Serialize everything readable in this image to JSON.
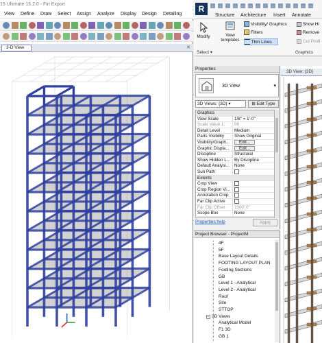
{
  "etabs": {
    "title": "15 Ultimate 15.2.0 - Fin Export",
    "menu": [
      "View",
      "Define",
      "Draw",
      "Select",
      "Assign",
      "Analyze",
      "Display",
      "Design",
      "Detailing"
    ],
    "view_tab": "3-D View",
    "colors": {
      "frame": "#2f3f9e",
      "slab": "#7d7d7d",
      "grid": "#c9c9c9"
    }
  },
  "revit": {
    "logo": "R",
    "ribbon_tabs": [
      "Structure",
      "Architecture",
      "Insert",
      "Annotate"
    ],
    "ribbon": {
      "modify": "Modify",
      "view_templates": "View templates",
      "visibility_graphics": "Visibility/ Graphics",
      "filters": "Filters",
      "thin_lines": "Thin Lines",
      "show_hidden": "Show Hi",
      "remove": "Remove",
      "cut_profile": "Cut Profi",
      "select_panel": "Select",
      "graphics_panel": "Graphics"
    },
    "properties": {
      "title": "Properties",
      "type_name": "3D View",
      "instance": "3D Views: {3D}",
      "edit_type": "Edit Type",
      "rows": [
        {
          "k": "Graphics",
          "v": "",
          "group": true
        },
        {
          "k": "View Scale",
          "v": "1/8\" = 1'-0\""
        },
        {
          "k": "Scale Value 1:",
          "v": "96",
          "disabled": true
        },
        {
          "k": "Detail Level",
          "v": "Medium"
        },
        {
          "k": "Parts Visibility",
          "v": "Show Original"
        },
        {
          "k": "Visibility/Graph...",
          "v": "Edit...",
          "button": true
        },
        {
          "k": "Graphic Displa...",
          "v": "Edit...",
          "button": true
        },
        {
          "k": "Discipline",
          "v": "Structural"
        },
        {
          "k": "Show Hidden L...",
          "v": "By Discipline"
        },
        {
          "k": "Default Analysi...",
          "v": "None"
        },
        {
          "k": "Sun Path",
          "v": "",
          "check": true
        },
        {
          "k": "Extents",
          "v": "",
          "group": true
        },
        {
          "k": "Crop View",
          "v": "",
          "check": true
        },
        {
          "k": "Crop Region Vi...",
          "v": "",
          "check": true
        },
        {
          "k": "Annotation Crop",
          "v": "",
          "check": true
        },
        {
          "k": "Far Clip Active",
          "v": "",
          "check": true
        },
        {
          "k": "Far Clip Offset",
          "v": "1000' 0\"",
          "disabled": true
        },
        {
          "k": "Scope Box",
          "v": "None"
        }
      ],
      "help": "Properties help",
      "apply": "Apply"
    },
    "browser": {
      "title": "Project Browser - ProjectM",
      "items": [
        {
          "label": "4F",
          "indent": 2
        },
        {
          "label": "5F",
          "indent": 2
        },
        {
          "label": "Base Layout Details",
          "indent": 2
        },
        {
          "label": "FOOTING LAYOUT PLAN",
          "indent": 2
        },
        {
          "label": "Footing Sections",
          "indent": 2
        },
        {
          "label": "GB",
          "indent": 2
        },
        {
          "label": "Level 1 - Analytical",
          "indent": 2
        },
        {
          "label": "Level 2 - Analytical",
          "indent": 2
        },
        {
          "label": "Roof",
          "indent": 2
        },
        {
          "label": "Site",
          "indent": 2
        },
        {
          "label": "STTOP",
          "indent": 2
        },
        {
          "label": "3D Views",
          "indent": 1,
          "toggle": "−"
        },
        {
          "label": "Analytical Model",
          "indent": 2
        },
        {
          "label": "F1 3D",
          "indent": 2
        },
        {
          "label": "GB 1",
          "indent": 2
        }
      ]
    },
    "view_tab": "3D View: {3D}"
  }
}
